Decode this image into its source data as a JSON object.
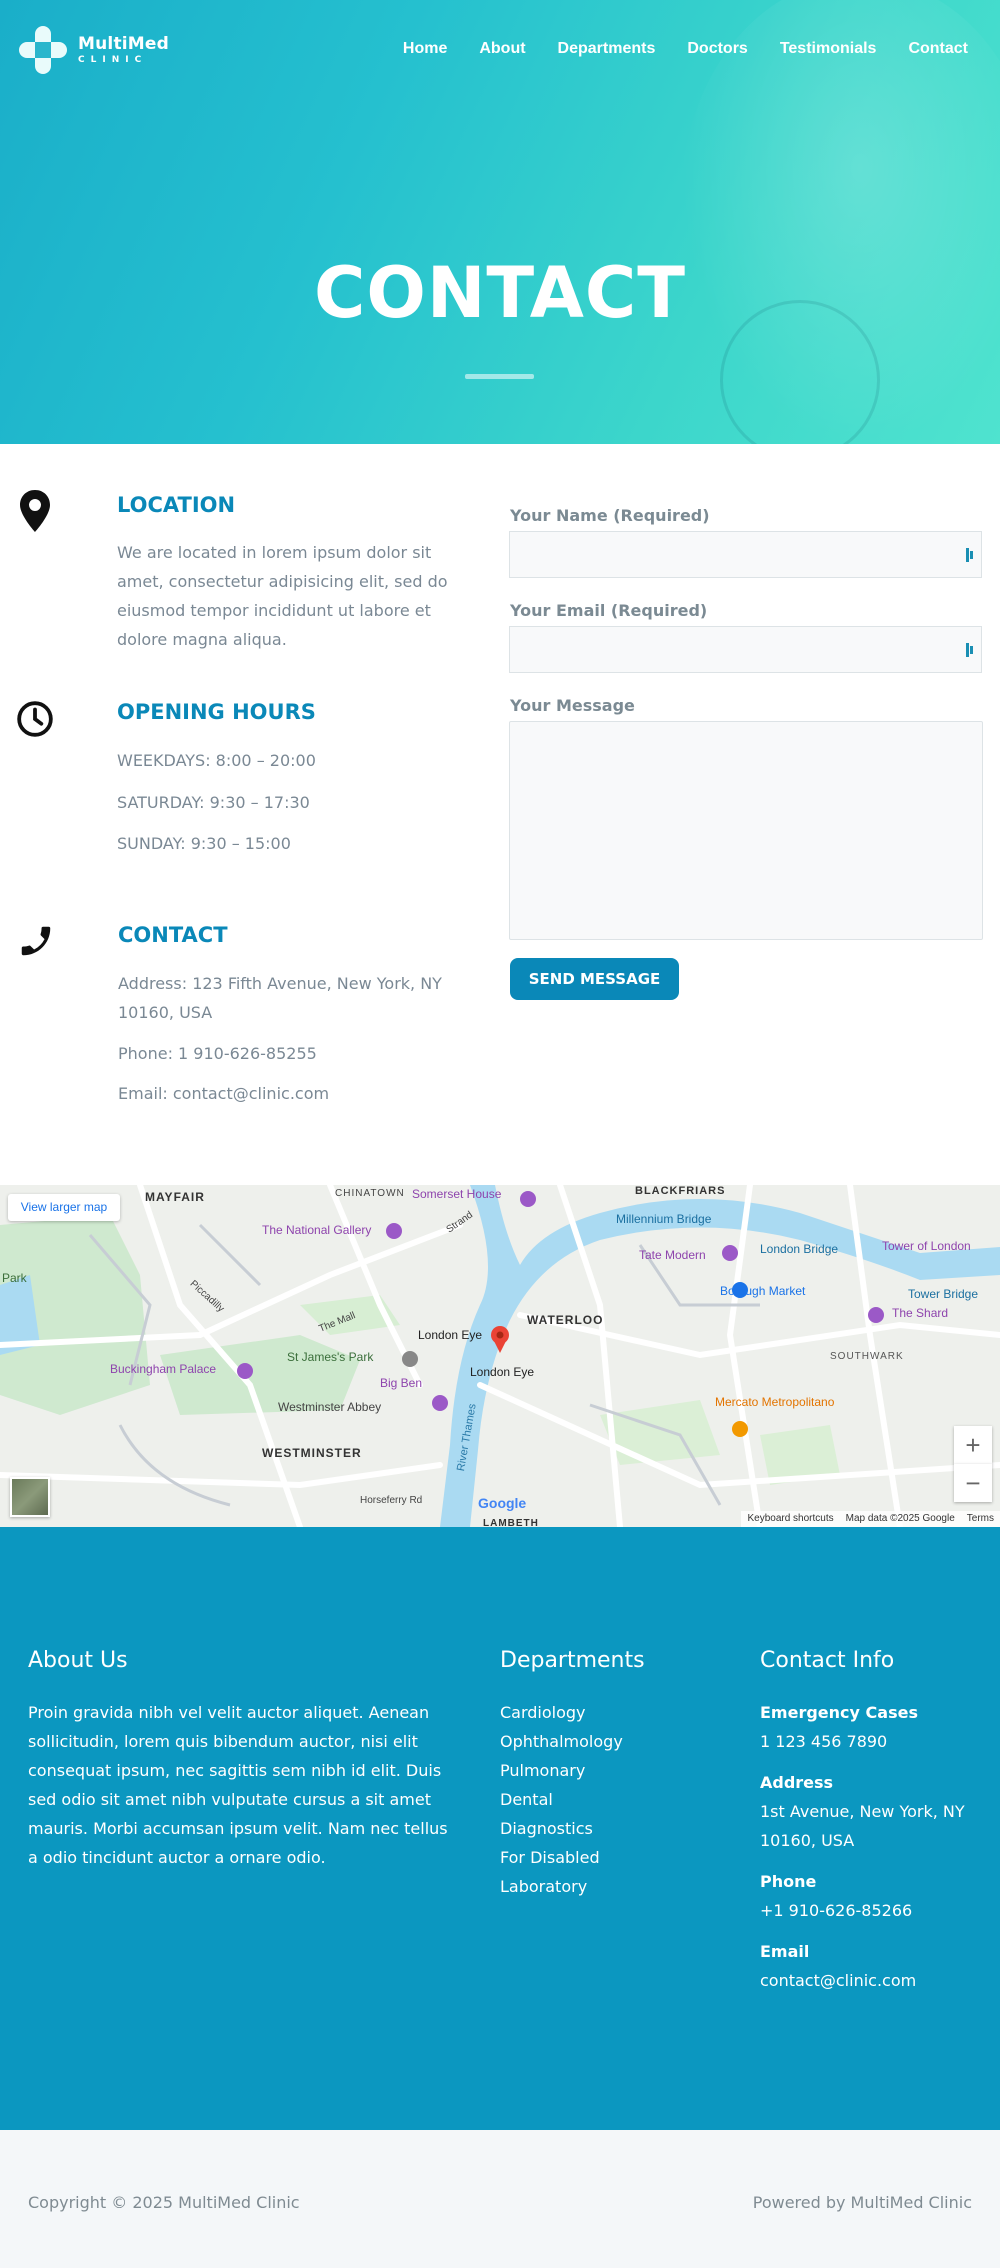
{
  "brand": {
    "name": "MultiMed",
    "sub": "CLINIC"
  },
  "nav": {
    "items": [
      "Home",
      "About",
      "Departments",
      "Doctors",
      "Testimonials",
      "Contact"
    ]
  },
  "hero": {
    "title": "CONTACT"
  },
  "location": {
    "title": "LOCATION",
    "text": "We are located in lorem ipsum dolor sit amet, consectetur adipisicing elit, sed do eiusmod tempor incididunt ut labore et dolore magna aliqua."
  },
  "hours": {
    "title": "OPENING HOURS",
    "weekdays": "WEEKDAYS: 8:00 – 20:00",
    "saturday": "SATURDAY: 9:30 – 17:30",
    "sunday": "SUNDAY: 9:30 – 15:00"
  },
  "contact": {
    "title": "CONTACT",
    "address": "Address: 123 Fifth Avenue, New York, NY 10160, USA",
    "phone": "Phone: 1 910-626-85255",
    "email": "Email: contact@clinic.com"
  },
  "form": {
    "name_label": "Your Name (Required)",
    "email_label": "Your Email (Required)",
    "message_label": "Your Message",
    "name_value": "",
    "email_value": "",
    "message_value": "",
    "submit": "SEND MESSAGE"
  },
  "map": {
    "view_larger": "View larger map",
    "zoom_in": "+",
    "zoom_out": "−",
    "keyboard": "Keyboard shortcuts",
    "map_data": "Map data ©2025 Google",
    "terms": "Terms",
    "google": "Google",
    "labels": {
      "mayfair": "MAYFAIR",
      "chinatown": "CHINATOWN",
      "somerset": "Somerset House",
      "blackfriars": "BLACKFRIARS",
      "national_gallery": "The National Gallery",
      "millennium": "Millennium Bridge",
      "london_bridge": "London Bridge",
      "tower_london": "Tower of London",
      "tate": "Tate Modern",
      "borough": "Borough Market",
      "tower_bridge": "Tower Bridge",
      "shard": "The Shard",
      "waterloo": "WATERLOO",
      "london_eye": "London Eye",
      "london_eye2": "London Eye",
      "southwark": "SOUTHWARK",
      "buckingham": "Buckingham Palace",
      "st_james": "St James's Park",
      "big_ben": "Big Ben",
      "westminster_abbey": "Westminster Abbey",
      "westminster": "WESTMINSTER",
      "mercato": "Mercato Metropolitano",
      "river": "River Thames",
      "the_mall": "The Mall",
      "piccadilly": "Piccadilly",
      "strand": "Strand",
      "horseferry": "Horseferry Rd",
      "lambeth": "LAMBETH",
      "park": "Park"
    }
  },
  "footer": {
    "about_title": "About Us",
    "about_text": "Proin gravida nibh vel velit auctor aliquet. Aenean sollicitudin, lorem quis bibendum auctor, nisi elit consequat ipsum, nec sagittis sem nibh id elit. Duis sed odio sit amet nibh vulputate cursus a sit amet mauris. Morbi accumsan ipsum velit. Nam nec tellus a odio tincidunt auctor a ornare odio.",
    "departments_title": "Departments",
    "departments": [
      "Cardiology",
      "Ophthalmology",
      "Pulmonary",
      "Dental",
      "Diagnostics",
      "For Disabled",
      "Laboratory"
    ],
    "contact_title": "Contact Info",
    "emergency_label": "Emergency Cases",
    "emergency_value": "1 123 456 7890",
    "address_label": "Address",
    "address_value": "1st Avenue, New York, NY 10160, USA",
    "phone_label": "Phone",
    "phone_value": "+1 910-626-85266",
    "email_label": "Email",
    "email_value": "contact@clinic.com"
  },
  "bottom": {
    "copyright": "Copyright © 2025 MultiMed Clinic",
    "powered": "Powered by MultiMed Clinic"
  },
  "colors": {
    "accent": "#0a88b8",
    "footer": "#0b97c0",
    "hero_start": "#1aaec9",
    "hero_end": "#4fe3cf"
  }
}
